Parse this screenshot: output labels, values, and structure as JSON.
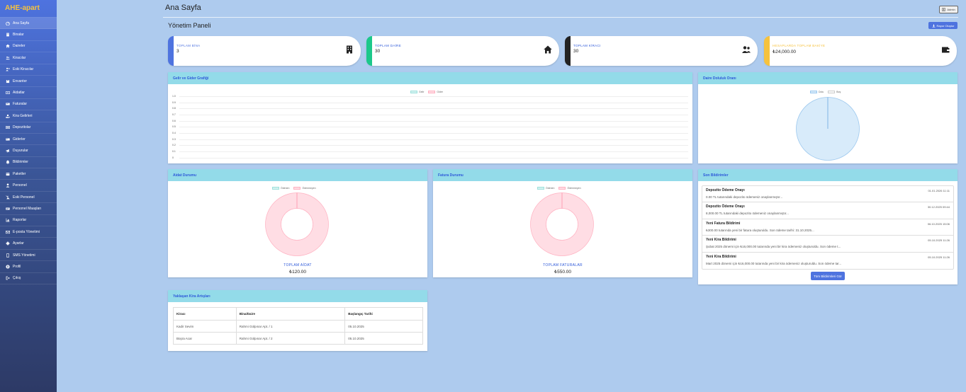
{
  "brand": "AHE-apart",
  "sidebar": {
    "items": [
      {
        "label": "Ana Sayfa",
        "icon": "dashboard-icon"
      },
      {
        "label": "Binalar",
        "icon": "building-icon"
      },
      {
        "label": "Daireler",
        "icon": "home-icon"
      },
      {
        "label": "Kiracılar",
        "icon": "users-icon"
      },
      {
        "label": "Eski Kiracılar",
        "icon": "user-times-icon"
      },
      {
        "label": "Envanter",
        "icon": "box-icon"
      },
      {
        "label": "Aidatlar",
        "icon": "money-bill-icon"
      },
      {
        "label": "Faturalar",
        "icon": "file-invoice-icon"
      },
      {
        "label": "Kira Gelirleri",
        "icon": "hand-holding-icon"
      },
      {
        "label": "Depozitolar",
        "icon": "wallet-icon"
      },
      {
        "label": "Giderler",
        "icon": "receipt-icon"
      },
      {
        "label": "Duyurular",
        "icon": "bullhorn-icon"
      },
      {
        "label": "Bildirimler",
        "icon": "bell-icon"
      },
      {
        "label": "Paketler",
        "icon": "package-icon"
      },
      {
        "label": "Personel",
        "icon": "user-tie-icon"
      },
      {
        "label": "Eski Personel",
        "icon": "user-slash-icon"
      },
      {
        "label": "Personel Maaşları",
        "icon": "money-check-icon"
      },
      {
        "label": "Raporlar",
        "icon": "chart-bar-icon"
      },
      {
        "label": "E-posta Yönetimi",
        "icon": "envelope-icon"
      },
      {
        "label": "Ayarlar",
        "icon": "gear-icon"
      },
      {
        "label": "SMS Yönetimi",
        "icon": "mobile-icon"
      },
      {
        "label": "Profil",
        "icon": "user-circle-icon"
      },
      {
        "label": "Çıkış",
        "icon": "sign-out-icon"
      }
    ]
  },
  "header": {
    "title": "Ana Sayfa",
    "user": "Admin"
  },
  "main": {
    "subtitle": "Yönetim Paneli",
    "report_button": "Rapor Oluştur",
    "stats": [
      {
        "label": "TOPLAM BİNA",
        "value": "3",
        "color": "#4e73df",
        "label_color": "#4e73df",
        "icon": "building-icon"
      },
      {
        "label": "TOPLAM DAİRE",
        "value": "30",
        "color": "#1cc88a",
        "label_color": "#2e59d9",
        "icon": "home-icon"
      },
      {
        "label": "TOPLAM KİRACI",
        "value": "30",
        "color": "#222222",
        "label_color": "#2e59d9",
        "icon": "users-icon"
      },
      {
        "label": "HESAPLARDA TOPLAM BAKİYE",
        "value": "₺24,000.00",
        "color": "#f6c23e",
        "label_color": "#f6c23e",
        "icon": "wallet-icon"
      }
    ],
    "income_chart": {
      "title": "Gelir ve Gider Grafiği",
      "chart_data": {
        "type": "line",
        "series": [
          {
            "name": "Gelir",
            "values": []
          },
          {
            "name": "Gider",
            "values": []
          }
        ],
        "yticks": [
          "1.0",
          "0.9",
          "0.8",
          "0.7",
          "0.6",
          "0.5",
          "0.4",
          "0.3",
          "0.2",
          "0.1",
          "0"
        ],
        "ylim": [
          0,
          1
        ],
        "colors": [
          "#d4f3f1",
          "#ffdde4"
        ]
      }
    },
    "occupancy_chart": {
      "title": "Daire Doluluk Oranı",
      "chart_data": {
        "type": "pie",
        "labels": [
          "Dolu",
          "Boş"
        ],
        "values": [
          30,
          0
        ],
        "colors": [
          "#d8ebfa",
          "#fafafa"
        ]
      }
    },
    "dues_chart": {
      "title": "Aidat Durumu",
      "legend": [
        "Ödenen",
        "Ödenmeyen"
      ],
      "total_label": "TOPLAM AİDAT",
      "total_value": "₺120.00",
      "chart_data": {
        "type": "pie",
        "labels": [
          "Ödenen",
          "Ödenmeyen"
        ],
        "values": [
          0,
          120
        ],
        "colors": [
          "#d4f3f1",
          "#ffdde4"
        ]
      }
    },
    "bills_chart": {
      "title": "Fatura Durumu",
      "legend": [
        "Ödenen",
        "Ödenmeyen"
      ],
      "total_label": "TOPLAM FATURALAR",
      "total_value": "₺550.00",
      "chart_data": {
        "type": "pie",
        "labels": [
          "Ödenen",
          "Ödenmeyen"
        ],
        "values": [
          0,
          550
        ],
        "colors": [
          "#d4f3f1",
          "#ffdde4"
        ]
      }
    },
    "notifications": {
      "title": "Son Bildirimler",
      "button": "Tüm Bildirimleri Gör",
      "items": [
        {
          "title": "Depozito Ödeme Onayı",
          "date": "01.01.2026 11:11",
          "message": "0.00 TL tutarındaki depozito ödemeniz onaylanmıştır..."
        },
        {
          "title": "Depozito Ödeme Onayı",
          "date": "30.12.2025 09:44",
          "message": "8,000.00 TL tutarındaki depozito ödemeniz onaylanmıştır..."
        },
        {
          "title": "Yeni Fatura Bildirimi",
          "date": "06.10.2025 15:06",
          "message": "₺300.00 tutarında yeni bir fatura oluşturuldu. Son ödeme tarihi: 31.10.2025..."
        },
        {
          "title": "Yeni Kira Bildirimi",
          "date": "05.10.2025 11:26",
          "message": "Şubat 2025 dönemi için ₺16,000.00 tutarında yeni bir kira ödemeniz oluşturuldu. Son ödeme t..."
        },
        {
          "title": "Yeni Kira Bildirimi",
          "date": "05.10.2025 11:26",
          "message": "Mart 2025 dönemi için ₺16,000.00 tutarında yeni bir kira ödemeniz oluşturuldu. Son ödeme tar..."
        }
      ]
    },
    "rent_increases": {
      "title": "Yaklaşan Kira Artışları",
      "columns": [
        "Kiracı",
        "Bina/Daire",
        "Başlangıç Tarihi"
      ],
      "rows": [
        [
          "Kadir Sevim",
          "Rahmi Gülpınar Apt. / 1",
          "05.10.2025"
        ],
        [
          "Büşra Acar",
          "Rahmi Gülpınar Apt. / 2",
          "05.10.2025"
        ]
      ]
    }
  }
}
